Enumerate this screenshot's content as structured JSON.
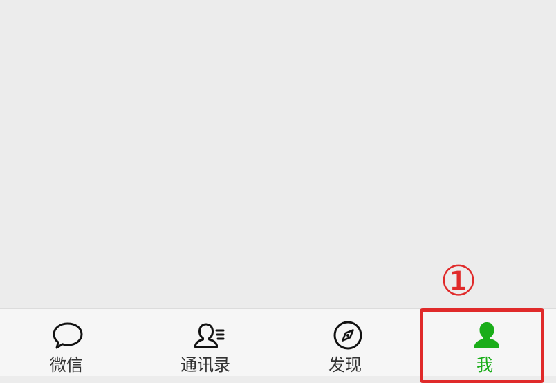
{
  "colors": {
    "background": "#ececec",
    "tab_bar": "#f6f6f6",
    "active_green": "#1aad19",
    "inactive_text": "#333333",
    "annotation_red": "#e02a2a"
  },
  "annotation": {
    "step_marker": "①"
  },
  "tab_bar": {
    "tabs": [
      {
        "label": "微信",
        "icon": "chat-bubble-icon",
        "active": false
      },
      {
        "label": "通讯录",
        "icon": "contacts-icon",
        "active": false
      },
      {
        "label": "发现",
        "icon": "compass-icon",
        "active": false
      },
      {
        "label": "我",
        "icon": "person-icon",
        "active": true
      }
    ]
  }
}
